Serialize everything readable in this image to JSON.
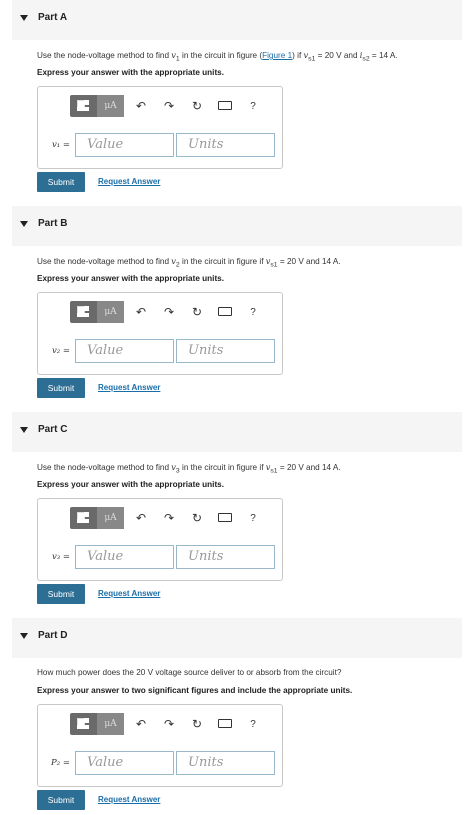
{
  "parts": [
    {
      "title": "Part A",
      "prompt_before": "Use the node-voltage method to find ",
      "var_sym": "v",
      "var_sub": "1",
      "prompt_mid1": " in the circuit in figure (",
      "figure_link": "Figure 1",
      "prompt_mid2": ") if ",
      "cond1_sym": "v",
      "cond1_sub": "s1",
      "cond1_val": " = 20 V",
      "cond_and": " and ",
      "cond2_sym": "i",
      "cond2_sub": "s2",
      "cond2_val": " = 14 A.",
      "instruction": "Express your answer with the appropriate units.",
      "input_label": "v₁ =",
      "value_placeholder": "Value",
      "units_placeholder": "Units",
      "submit_label": "Submit",
      "request_label": "Request Answer"
    },
    {
      "title": "Part B",
      "prompt_before": "Use the node-voltage method to find ",
      "var_sym": "v",
      "var_sub": "2",
      "prompt_mid1": " in the circuit in figure if ",
      "cond1_sym": "v",
      "cond1_sub": "s1",
      "cond1_val": " = 20 V and 14 A.",
      "instruction": "Express your answer with the appropriate units.",
      "input_label": "v₂ =",
      "value_placeholder": "Value",
      "units_placeholder": "Units",
      "submit_label": "Submit",
      "request_label": "Request Answer"
    },
    {
      "title": "Part C",
      "prompt_before": "Use the node-voltage method to find ",
      "var_sym": "v",
      "var_sub": "3",
      "prompt_mid1": " in the circuit in figure if ",
      "cond1_sym": "v",
      "cond1_sub": "s1",
      "cond1_val": " = 20 V and 14 A.",
      "instruction": "Express your answer with the appropriate units.",
      "input_label": "v₃ =",
      "value_placeholder": "Value",
      "units_placeholder": "Units",
      "submit_label": "Submit",
      "request_label": "Request Answer"
    },
    {
      "title": "Part D",
      "prompt_text": "How much power does the 20 V voltage source deliver to or absorb from the circuit?",
      "instruction": "Express your answer to two significant figures and include the appropriate units.",
      "input_label": "P₂ =",
      "value_placeholder": "Value",
      "units_placeholder": "Units",
      "submit_label": "Submit",
      "request_label": "Request Answer"
    }
  ],
  "toolbar": {
    "units_label": "μA",
    "undo_icon": "↶",
    "redo_icon": "↷",
    "reset_icon": "↻",
    "help_label": "?"
  }
}
